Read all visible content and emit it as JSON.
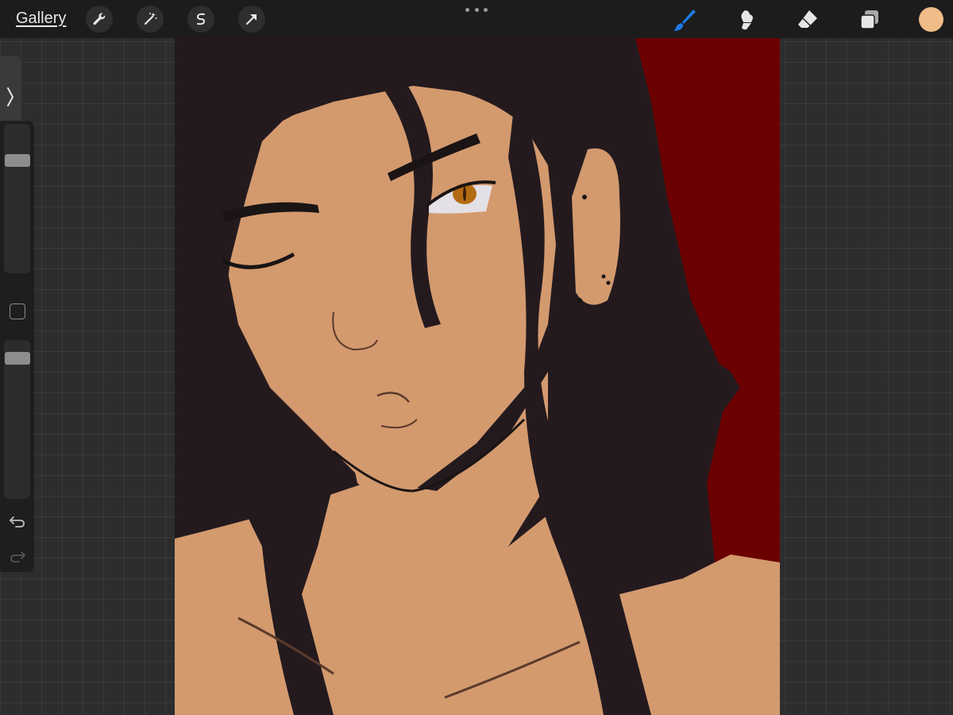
{
  "topbar": {
    "gallery_label": "Gallery",
    "left_tools": [
      {
        "name": "actions",
        "icon": "wrench-icon"
      },
      {
        "name": "adjustments",
        "icon": "magic-wand-icon"
      },
      {
        "name": "selection",
        "icon": "selection-s-icon"
      },
      {
        "name": "transform",
        "icon": "arrow-icon"
      }
    ],
    "more_icon": "ellipsis-icon",
    "right_tools": [
      {
        "name": "brush",
        "icon": "brush-icon",
        "active": true
      },
      {
        "name": "smudge",
        "icon": "smudge-icon",
        "active": false
      },
      {
        "name": "eraser",
        "icon": "eraser-icon",
        "active": false
      },
      {
        "name": "layers",
        "icon": "layers-icon",
        "active": false
      }
    ],
    "active_color": "#f0bc88"
  },
  "sidebar": {
    "toggle_icon": "chevron-right-icon",
    "brush_size_level": 0.79,
    "opacity_level": 0.94,
    "modify_icon": "square-icon",
    "undo_icon": "undo-icon",
    "redo_icon": "redo-icon"
  },
  "canvas": {
    "colors": {
      "background": "#6b0000",
      "skin": "#d39a6e",
      "hair": "#241a1e",
      "line": "#1a1414",
      "iris": "#b56b14",
      "eye_white": "#e3e0e6"
    }
  },
  "theme": {
    "accent": "#1f7ae6",
    "toolbar_bg": "#1c1c1c",
    "workspace_bg": "#2d2d2d"
  }
}
